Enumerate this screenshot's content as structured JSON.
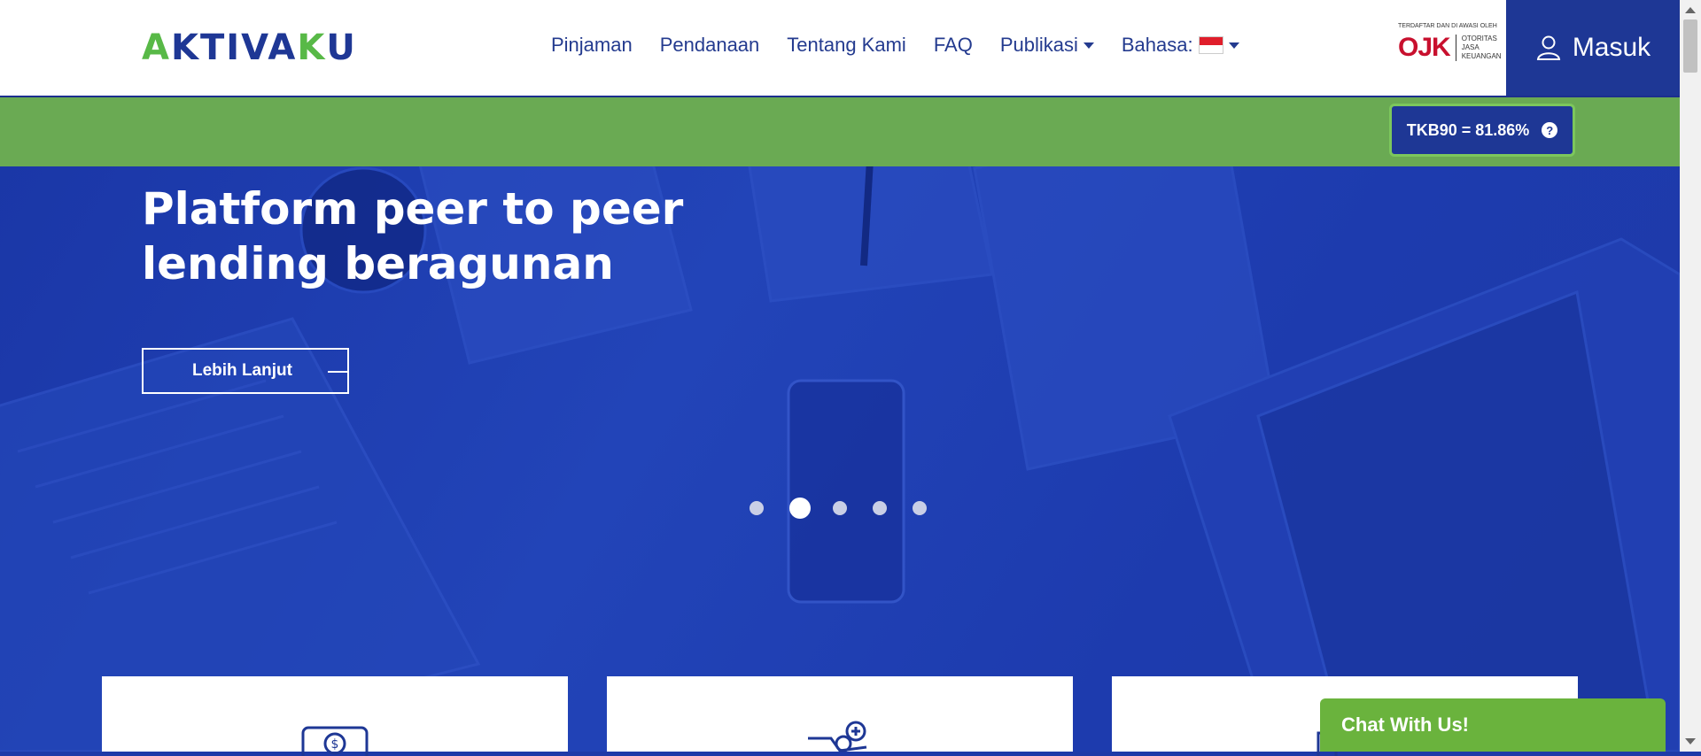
{
  "header": {
    "logo": {
      "part1": "A",
      "part2": "KTIVA",
      "part3": "K",
      "part4": "U"
    },
    "nav": [
      {
        "label": "Pinjaman"
      },
      {
        "label": "Pendanaan"
      },
      {
        "label": "Tentang Kami"
      },
      {
        "label": "FAQ"
      },
      {
        "label": "Publikasi"
      },
      {
        "label": "Bahasa:"
      }
    ],
    "ojk": {
      "caption": "TERDAFTAR DAN DI AWASI OLEH",
      "mark": "OJK",
      "line1": "OTORITAS",
      "line2": "JASA",
      "line3": "KEUANGAN"
    },
    "login_label": "Masuk"
  },
  "tkb": {
    "label": "TKB90 = 81.86%"
  },
  "hero": {
    "title": "Platform peer to peer lending beragunan",
    "cta_label": "Lebih Lanjut",
    "slides_total": 5,
    "active_slide": 2
  },
  "chat": {
    "label": "Chat With Us!"
  },
  "colors": {
    "brand_blue": "#1e3795",
    "brand_green": "#58b947",
    "band_green": "#6aaa53",
    "chat_green": "#6ab33d",
    "hero_blue": "#1e3aa8"
  },
  "icons": {
    "help": "question-circle-icon",
    "user": "user-icon",
    "dropdown": "caret-down-icon"
  }
}
